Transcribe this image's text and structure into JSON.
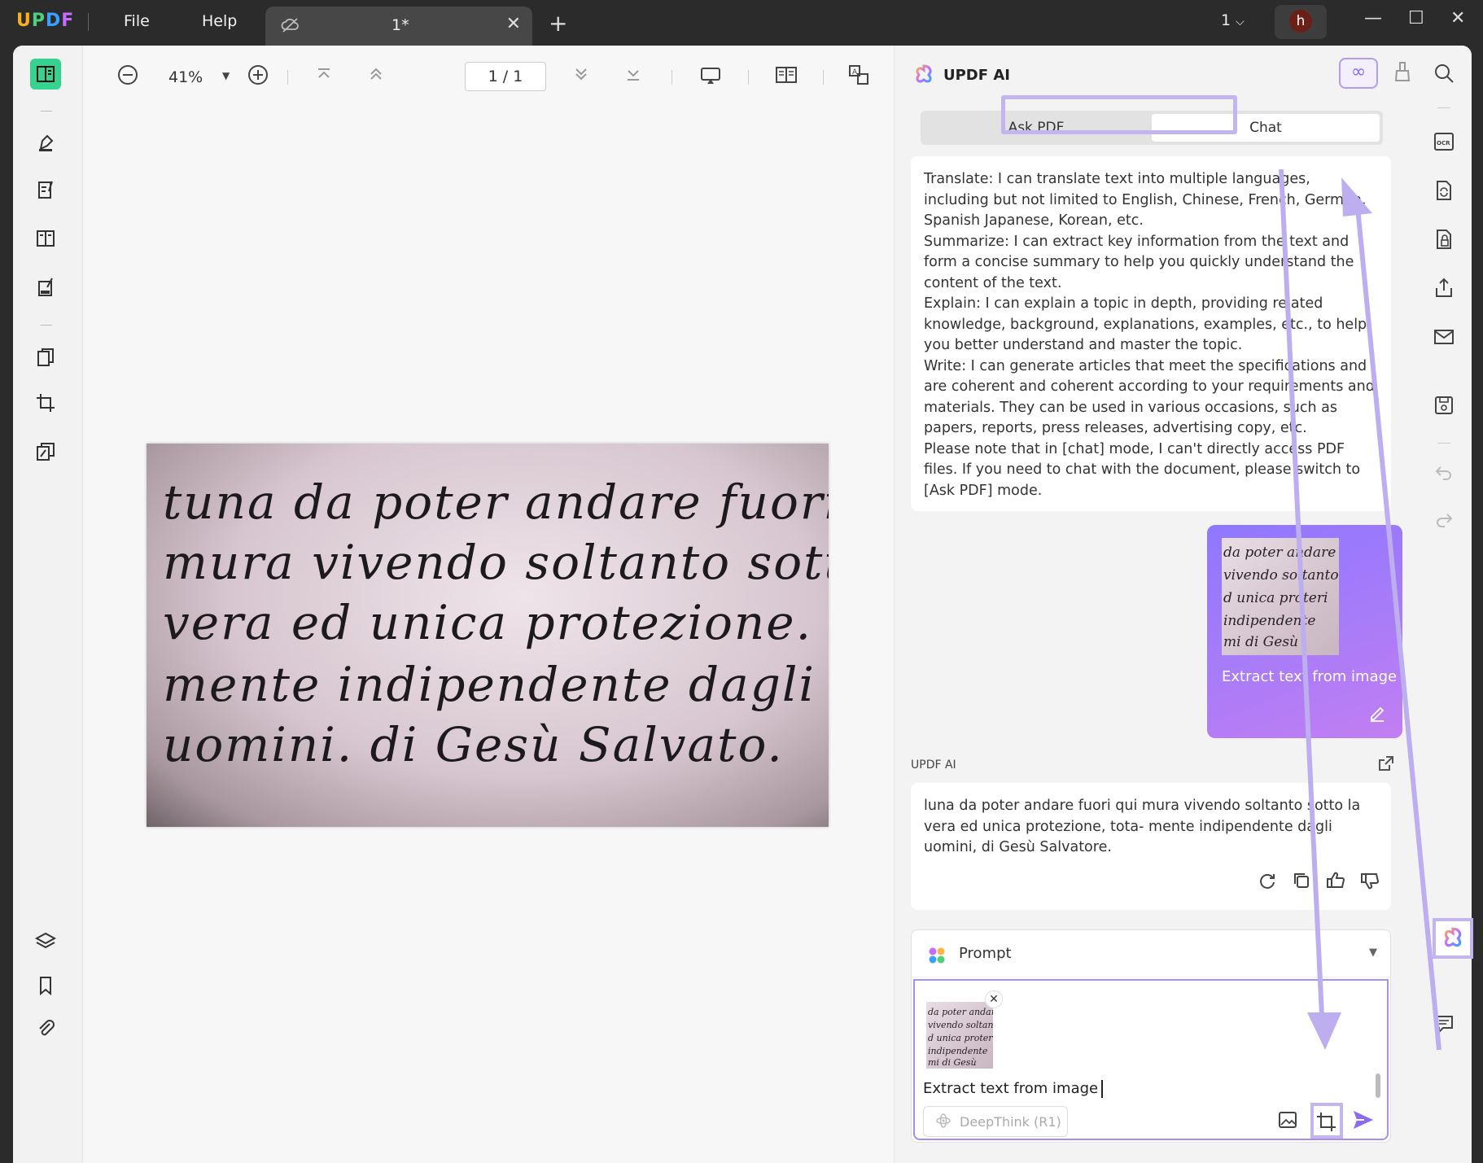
{
  "titlebar": {
    "logo": "UPDF",
    "menu": [
      "File",
      "Help"
    ],
    "tab_name": "1*",
    "page_indicator": "1"
  },
  "avatar": {
    "initial": "h"
  },
  "viewer": {
    "zoom": "41%",
    "page_value": "1 / 1"
  },
  "document": {
    "lines": [
      "tuna da poter andare fuori qu",
      "mura vivendo soltanto sotto l",
      "vera ed unica protezione. tota",
      "mente indipendente dagli",
      "uomini. di Gesù Salvato."
    ]
  },
  "ai_panel": {
    "title": "UPDF AI",
    "tabs": {
      "ask": "Ask PDF",
      "chat": "Chat"
    },
    "intro_paragraphs": [
      "Translate: I can translate text into multiple languages, including but not limited to English, Chinese, French, German, Spanish Japanese, Korean, etc.",
      "Summarize: I can extract key information from the text and form a concise summary to help you quickly understand the content of the text.",
      "Explain: I can explain a topic in depth, providing related knowledge, background, explanations, examples, etc., to help you better understand and master the topic.",
      "Write: I can generate articles that meet the specifications and are coherent and coherent according to your requirements and materials. They can be used in various occasions, such as papers, reports, press releases, advertising copy, etc.",
      "Please note that in [chat] mode, I can't directly access PDF files. If you need to chat with the document, please switch to [Ask PDF] mode."
    ],
    "user_message": "Extract text from image",
    "ai_label": "UPDF AI",
    "ai_reply": "luna da poter andare fuori qui mura vivendo soltanto sotto la vera ed unica protezione, tota- mente indipendente dagli uomini, di Gesù Salvatore.",
    "prompt_label": "Prompt",
    "input_value": "Extract text from image",
    "deepthink_label": "DeepThink (R1)",
    "infinity": "∞"
  },
  "colors": {
    "accent_purple": "#8f77ff",
    "highlight": "#c5b5ee",
    "active_green": "#35d290"
  }
}
